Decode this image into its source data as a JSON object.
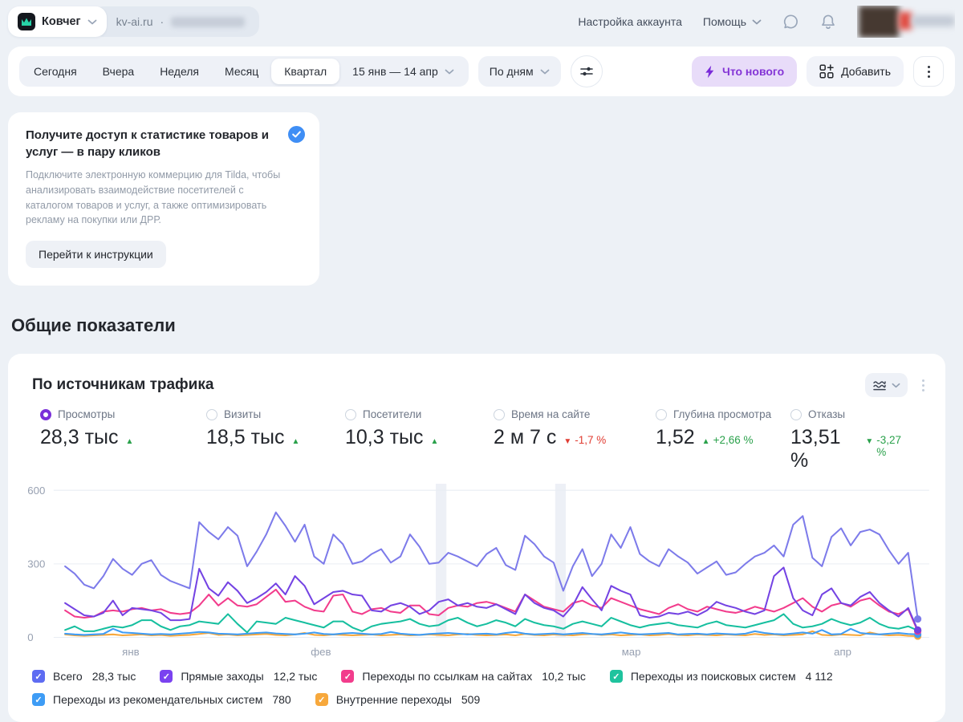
{
  "topbar": {
    "counter_name": "Ковчег",
    "domain": "kv-ai.ru",
    "separator": "·",
    "account_settings": "Настройка аккаунта",
    "help": "Помощь"
  },
  "toolbar": {
    "periods": [
      "Сегодня",
      "Вчера",
      "Неделя",
      "Месяц",
      "Квартал"
    ],
    "selected_period": "Квартал",
    "date_range": "15 янв — 14 апр",
    "granularity": "По дням",
    "whats_new": "Что нового",
    "add": "Добавить"
  },
  "promo": {
    "title": "Получите доступ к статистике товаров и услуг — в пару кликов",
    "body": "Подключите электронную коммерцию для Tilda, чтобы анализировать взаимодействие посетителей с каталогом товаров и услуг, а также оптимизировать рекламу на покупки или ДРР.",
    "button": "Перейти к инструкции"
  },
  "section_title": "Общие показатели",
  "traffic": {
    "title": "По источникам трафика",
    "metrics": [
      {
        "label": "Просмотры",
        "value": "28,3 тыс",
        "trend": "up",
        "trend_color": "#2aa14b",
        "delta": "",
        "selected": true
      },
      {
        "label": "Визиты",
        "value": "18,5 тыс",
        "trend": "up",
        "trend_color": "#2aa14b",
        "delta": "",
        "selected": false
      },
      {
        "label": "Посетители",
        "value": "10,3 тыс",
        "trend": "up",
        "trend_color": "#2aa14b",
        "delta": "",
        "selected": false
      },
      {
        "label": "Время на сайте",
        "value": "2 м 7 с",
        "trend": "down",
        "trend_color": "#e03c32",
        "delta": "-1,7 %",
        "selected": false
      },
      {
        "label": "Глубина просмотра",
        "value": "1,52",
        "trend": "up",
        "trend_color": "#2aa14b",
        "delta": "+2,66 %",
        "selected": false
      },
      {
        "label": "Отказы",
        "value": "13,51 %",
        "trend": "down",
        "trend_color": "#2aa14b",
        "delta": "-3,27 %",
        "selected": false
      }
    ]
  },
  "chart_data": {
    "type": "line",
    "title": "По источникам трафика",
    "x_range": "15 янв — 14 апр, по дням",
    "ylim": [
      0,
      600
    ],
    "y_ticks": [
      0,
      300,
      600
    ],
    "x_ticks": [
      {
        "label": "янв",
        "pos": 0.077
      },
      {
        "label": "фев",
        "pos": 0.3
      },
      {
        "label": "мар",
        "pos": 0.664
      },
      {
        "label": "апр",
        "pos": 0.912
      }
    ],
    "holiday_bands": [
      {
        "pos": 0.441
      },
      {
        "pos": 0.581
      }
    ],
    "grid": true,
    "legend_position": "bottom",
    "series": [
      {
        "name": "Всего",
        "total": "28,3 тыс",
        "color": "#7d7bea",
        "swatch": "#5e6cf2",
        "values": [
          290,
          260,
          215,
          200,
          250,
          320,
          280,
          255,
          300,
          315,
          255,
          230,
          215,
          200,
          470,
          430,
          400,
          450,
          415,
          290,
          350,
          420,
          510,
          455,
          390,
          460,
          330,
          300,
          420,
          380,
          300,
          310,
          340,
          360,
          305,
          330,
          420,
          370,
          300,
          305,
          345,
          330,
          310,
          290,
          340,
          365,
          295,
          275,
          415,
          380,
          330,
          305,
          190,
          290,
          360,
          250,
          300,
          420,
          365,
          450,
          340,
          310,
          290,
          360,
          330,
          305,
          260,
          285,
          310,
          255,
          265,
          300,
          330,
          345,
          375,
          330,
          460,
          495,
          325,
          290,
          410,
          445,
          375,
          430,
          440,
          420,
          355,
          300,
          345,
          75
        ]
      },
      {
        "name": "Прямые заходы",
        "total": "12,2 тыс",
        "color": "#7443e3",
        "swatch": "#7a42f0",
        "values": [
          140,
          115,
          90,
          85,
          100,
          150,
          90,
          120,
          115,
          110,
          100,
          70,
          70,
          75,
          280,
          200,
          170,
          225,
          190,
          140,
          160,
          185,
          220,
          175,
          250,
          210,
          135,
          160,
          185,
          190,
          175,
          170,
          110,
          105,
          130,
          140,
          125,
          95,
          110,
          145,
          155,
          130,
          140,
          125,
          120,
          135,
          115,
          95,
          175,
          140,
          120,
          110,
          85,
          130,
          205,
          155,
          110,
          210,
          190,
          175,
          90,
          80,
          85,
          100,
          95,
          105,
          90,
          110,
          145,
          130,
          120,
          105,
          95,
          110,
          250,
          285,
          160,
          110,
          90,
          175,
          200,
          140,
          130,
          165,
          185,
          140,
          110,
          85,
          120,
          30
        ]
      },
      {
        "name": "Переходы по ссылкам на сайтах",
        "total": "10,2 тыс",
        "color": "#f23c8c",
        "swatch": "#f23c8c",
        "values": [
          110,
          85,
          80,
          85,
          105,
          110,
          105,
          115,
          120,
          110,
          115,
          100,
          95,
          100,
          130,
          175,
          130,
          160,
          130,
          125,
          135,
          165,
          195,
          145,
          150,
          125,
          110,
          105,
          170,
          175,
          105,
          95,
          115,
          120,
          105,
          100,
          130,
          130,
          95,
          90,
          120,
          130,
          125,
          140,
          145,
          135,
          120,
          105,
          175,
          150,
          125,
          115,
          105,
          140,
          150,
          130,
          120,
          160,
          145,
          130,
          115,
          105,
          95,
          120,
          135,
          115,
          105,
          125,
          115,
          105,
          100,
          110,
          125,
          115,
          105,
          120,
          140,
          160,
          125,
          105,
          130,
          140,
          125,
          150,
          160,
          130,
          105,
          95,
          115,
          25
        ]
      },
      {
        "name": "Переходы из поисковых систем",
        "total": "4 112",
        "color": "#16bf9f",
        "swatch": "#1fc39e",
        "values": [
          30,
          45,
          25,
          25,
          35,
          45,
          40,
          50,
          70,
          70,
          45,
          30,
          45,
          50,
          65,
          60,
          55,
          95,
          55,
          20,
          65,
          60,
          55,
          80,
          70,
          60,
          50,
          40,
          65,
          65,
          40,
          25,
          45,
          55,
          60,
          65,
          75,
          55,
          45,
          50,
          70,
          80,
          60,
          45,
          55,
          70,
          60,
          45,
          75,
          60,
          50,
          45,
          35,
          55,
          65,
          55,
          45,
          80,
          65,
          50,
          40,
          50,
          55,
          60,
          50,
          45,
          40,
          55,
          65,
          50,
          45,
          40,
          50,
          60,
          70,
          95,
          55,
          40,
          45,
          55,
          75,
          60,
          50,
          60,
          80,
          55,
          40,
          35,
          45,
          28
        ]
      },
      {
        "name": "Переходы из рекомендательных систем",
        "total": "780",
        "color": "#3e9cf5",
        "swatch": "#3e9cf5",
        "values": [
          15,
          12,
          10,
          12,
          14,
          35,
          20,
          18,
          15,
          12,
          14,
          12,
          15,
          18,
          22,
          20,
          15,
          14,
          12,
          15,
          18,
          20,
          16,
          14,
          12,
          15,
          20,
          14,
          12,
          16,
          18,
          15,
          12,
          14,
          22,
          15,
          12,
          10,
          14,
          16,
          18,
          15,
          12,
          14,
          15,
          12,
          18,
          22,
          15,
          12,
          14,
          16,
          12,
          15,
          18,
          14,
          12,
          16,
          20,
          15,
          12,
          14,
          16,
          18,
          12,
          14,
          15,
          12,
          16,
          14,
          12,
          15,
          25,
          18,
          14,
          12,
          16,
          20,
          15,
          30,
          12,
          14,
          35,
          18,
          14,
          12,
          15,
          18,
          14,
          12
        ]
      },
      {
        "name": "Внутренние переходы",
        "total": "509",
        "color": "#f7a83c",
        "swatch": "#f7a83c",
        "values": [
          12,
          8,
          6,
          8,
          10,
          12,
          8,
          10,
          12,
          8,
          10,
          6,
          8,
          10,
          14,
          18,
          10,
          12,
          8,
          10,
          12,
          14,
          10,
          8,
          12,
          18,
          10,
          8,
          12,
          10,
          8,
          10,
          12,
          8,
          10,
          12,
          8,
          10,
          12,
          10,
          8,
          12,
          14,
          10,
          8,
          10,
          12,
          8,
          14,
          10,
          8,
          12,
          10,
          8,
          12,
          14,
          10,
          12,
          8,
          10,
          12,
          8,
          10,
          14,
          10,
          8,
          12,
          10,
          8,
          12,
          10,
          8,
          14,
          10,
          12,
          8,
          10,
          12,
          25,
          10,
          8,
          12,
          10,
          8,
          20,
          12,
          8,
          10,
          6,
          5
        ]
      }
    ]
  }
}
